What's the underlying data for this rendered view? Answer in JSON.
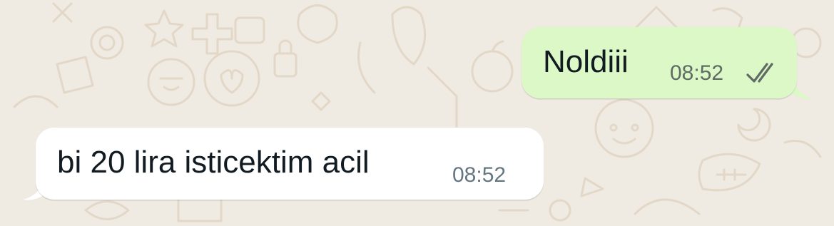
{
  "chat": {
    "messages": [
      {
        "direction": "outgoing",
        "text": "Noldiii",
        "time": "08:52",
        "status_icon": "double-check-icon"
      },
      {
        "direction": "incoming",
        "text": "bi 20 lira isticektim acil",
        "time": "08:52"
      }
    ]
  },
  "colors": {
    "wallpaper": "#efeae2",
    "outgoing_bubble": "#dcf8c6",
    "incoming_bubble": "#ffffff",
    "text": "#111b21",
    "meta": "#667781"
  }
}
